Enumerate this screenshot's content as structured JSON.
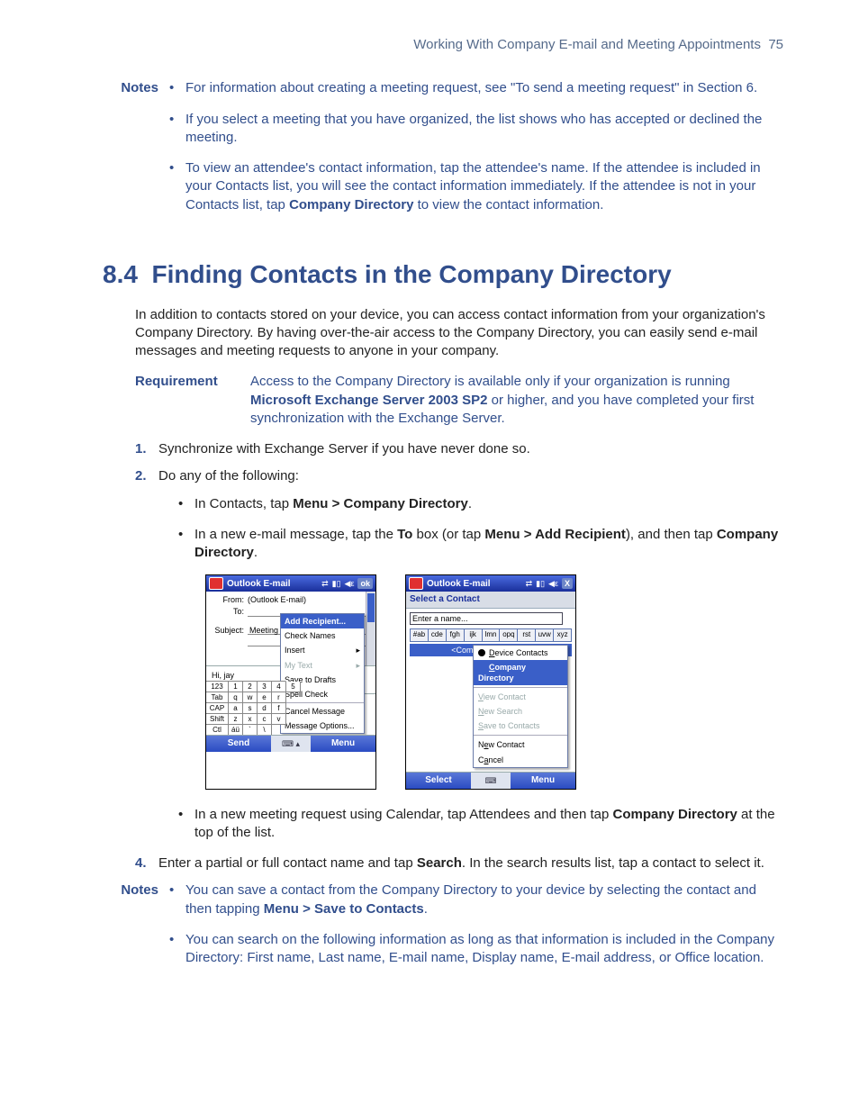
{
  "header": {
    "running": "Working With Company E-mail and Meeting Appointments",
    "page": "75"
  },
  "topnotes": {
    "label": "Notes",
    "items": [
      "For information about creating a meeting request, see \"To send a meeting request\" in Section 6.",
      "If you select a meeting that you have organized, the list shows who has accepted or declined the meeting.",
      {
        "pre": "To view an attendee's contact information, tap the attendee's name. If the attendee is included in your Contacts list, you will see the contact information immediately. If the attendee is not in your Contacts list, tap ",
        "b": "Company Directory",
        "post": " to view the contact information."
      }
    ]
  },
  "section": {
    "num": "8.4",
    "title": "Finding Contacts in the Company Directory"
  },
  "intro": "In addition to contacts stored on your device, you can access contact information from your organization's Company Directory. By having over-the-air access to the Company Directory, you can easily send e-mail messages and meeting requests to anyone in your company.",
  "requirement": {
    "label": "Requirement",
    "pre": "Access to the Company Directory is available only if your organization is running ",
    "b1": "Microsoft Exchange Server 2003 SP2",
    "post": " or higher, and you have completed your first synchronization with the Exchange Server."
  },
  "steps": {
    "s1": {
      "n": "1.",
      "t": "Synchronize with Exchange Server if you have never done so."
    },
    "s2": {
      "n": "2.",
      "t": "Do any of the following:"
    },
    "s2sub": [
      {
        "pre": "In Contacts, tap ",
        "b": "Menu > Company Directory",
        "post": "."
      },
      {
        "pre": "In a new e-mail message, tap the ",
        "b1": "To",
        "mid": " box (or tap ",
        "b2": "Menu > Add Recipient",
        "mid2": "), and then tap ",
        "b3": "Company Directory",
        "post": "."
      }
    ],
    "s2sub3": {
      "pre": "In a new meeting request using Calendar, tap Attendees and then tap ",
      "b": "Company Directory",
      "post": " at the top of the list."
    },
    "s4": {
      "n": "4.",
      "pre": "Enter a partial or full contact name and tap ",
      "b": "Search",
      "post": ". In the search results list, tap a contact to select it."
    }
  },
  "phone1": {
    "title": "Outlook E-mail",
    "ok": "ok",
    "from_lbl": "From:",
    "from_val": "(Outlook E-mail)",
    "to_lbl": "To:",
    "subj_lbl": "Subject:",
    "subj_val": "Meeting",
    "body": "Hi, jay",
    "menu": {
      "add": "Add Recipient...",
      "check": "Check Names",
      "insert": "Insert",
      "mytext": "My Text",
      "drafts": "Save to Drafts",
      "spell": "Spell Check",
      "cancel": "Cancel Message",
      "opts": "Message Options..."
    },
    "kbd": {
      "r1": [
        "123",
        "1",
        "2",
        "3",
        "4",
        "5"
      ],
      "r2": [
        "Tab",
        "q",
        "w",
        "e",
        "r"
      ],
      "r3": [
        "CAP",
        "a",
        "s",
        "d",
        "f"
      ],
      "r4": [
        "Shift",
        "z",
        "x",
        "c",
        "v"
      ],
      "r5": [
        "Ctl",
        "áü",
        "`",
        "\\"
      ]
    },
    "sk_left": "Send",
    "sk_right": "Menu",
    "mid": "⌨ ▴"
  },
  "phone2": {
    "title": "Outlook E-mail",
    "x": "X",
    "select_contact": "Select a Contact",
    "search_ph": "Enter a name...",
    "tabs": [
      "#ab",
      "cde",
      "fgh",
      "ijk",
      "lmn",
      "opq",
      "rst",
      "uvw",
      "xyz"
    ],
    "dir": "<Company Directory>",
    "menu": {
      "device": "Device Contacts",
      "company": "Company Directory",
      "view": "View Contact",
      "newsearch": "New Search",
      "save": "Save to Contacts",
      "newcontact": "New Contact",
      "cancel": "Cancel"
    },
    "sk_left": "Select",
    "sk_right": "Menu",
    "mid": "⌨"
  },
  "endnotes": {
    "label": "Notes",
    "items": [
      {
        "pre": "You can save a contact from the Company Directory to your device by selecting the contact and then tapping ",
        "b": "Menu > Save to Contacts",
        "post": "."
      },
      "You can search on the following information as long as that information is included in the Company Directory: First name, Last name, E-mail name, Display name, E-mail address, or Office location."
    ]
  }
}
